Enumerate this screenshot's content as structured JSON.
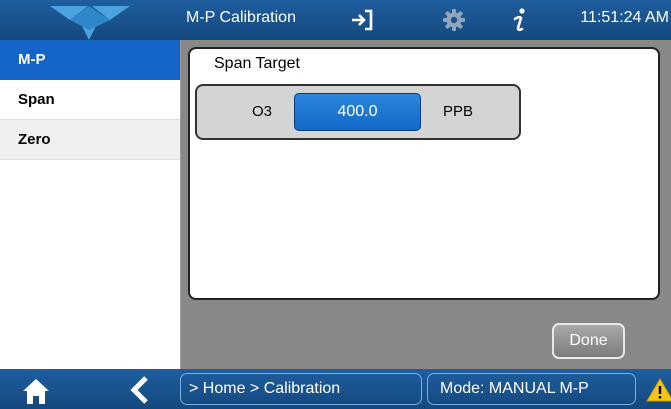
{
  "header": {
    "title": "M-P Calibration",
    "clock": "11:51:24 AM",
    "icons": [
      "logo-icon",
      "exit-icon",
      "gear-icon",
      "info-icon"
    ]
  },
  "sidebar": {
    "items": [
      {
        "label": "M-P",
        "active": true
      },
      {
        "label": "Span",
        "active": false
      },
      {
        "label": "Zero",
        "active": false
      }
    ]
  },
  "main": {
    "panel_title": "Span Target",
    "gas": "O3",
    "value": "400.0",
    "unit": "PPB",
    "done_label": "Done"
  },
  "footer": {
    "breadcrumb": "> Home > Calibration",
    "mode": "Mode: MANUAL M-P",
    "icons": [
      "home-icon",
      "back-arrow-icon",
      "warning-icon"
    ]
  },
  "colors": {
    "bar": "#1a5290",
    "accent": "#1465c7",
    "content_bg": "#888888"
  }
}
